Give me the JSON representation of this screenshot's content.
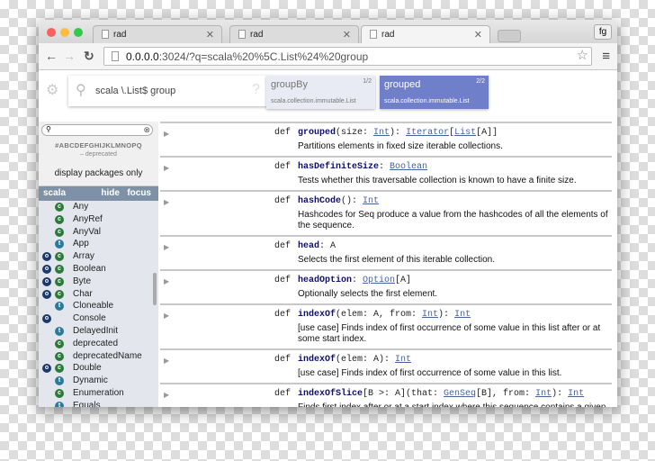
{
  "browser": {
    "tabs": [
      {
        "title": "rad"
      },
      {
        "title": "rad"
      },
      {
        "title": "rad"
      }
    ],
    "profile": "fg",
    "url_host": "0.0.0.0",
    "url_rest": ":3024/?q=scala%20%5C.List%24%20group"
  },
  "search": {
    "query": "scala \\.List$ group",
    "help": "?",
    "results": [
      {
        "name": "groupBy",
        "count": "1/2",
        "path": "scala.collection.immutable.List"
      },
      {
        "name": "grouped",
        "count": "2/2",
        "path": "scala.collection.immutable.List",
        "active": true
      }
    ]
  },
  "colors": {
    "active_result": "#6f7fc9",
    "inactive_result": "#e8eaf4",
    "package_header": "#7f91a6"
  },
  "sidebar": {
    "filter": "",
    "alphabet": "#ABCDEFGHIJKLMNOPQ",
    "deprecated": "– deprecated",
    "display_packages": "display packages only",
    "package": "scala",
    "hide": "hide",
    "focus": "focus",
    "items": [
      {
        "name": "Any",
        "o": false,
        "k": "c"
      },
      {
        "name": "AnyRef",
        "o": false,
        "k": "c"
      },
      {
        "name": "AnyVal",
        "o": false,
        "k": "c"
      },
      {
        "name": "App",
        "o": false,
        "k": "t"
      },
      {
        "name": "Array",
        "o": true,
        "k": "c"
      },
      {
        "name": "Boolean",
        "o": true,
        "k": "c"
      },
      {
        "name": "Byte",
        "o": true,
        "k": "c"
      },
      {
        "name": "Char",
        "o": true,
        "k": "c"
      },
      {
        "name": "Cloneable",
        "o": false,
        "k": "t"
      },
      {
        "name": "Console",
        "o": true,
        "k": ""
      },
      {
        "name": "DelayedInit",
        "o": false,
        "k": "t"
      },
      {
        "name": "deprecated",
        "o": false,
        "k": "c"
      },
      {
        "name": "deprecatedName",
        "o": false,
        "k": "c"
      },
      {
        "name": "Double",
        "o": true,
        "k": "c"
      },
      {
        "name": "Dynamic",
        "o": false,
        "k": "t"
      },
      {
        "name": "Enumeration",
        "o": false,
        "k": "c"
      },
      {
        "name": "Equals",
        "o": false,
        "k": "t"
      }
    ]
  },
  "members": [
    {
      "def": "def",
      "name": "grouped",
      "sig": [
        {
          "s": "(size: "
        },
        {
          "s": "Int",
          "l": 1
        },
        {
          "s": "): "
        },
        {
          "s": "Iterator",
          "l": 1
        },
        {
          "s": "["
        },
        {
          "s": "List",
          "l": 1
        },
        {
          "s": "[A]]"
        }
      ],
      "desc": "Partitions elements in fixed size iterable collections."
    },
    {
      "def": "def",
      "name": "hasDefiniteSize",
      "sig": [
        {
          "s": ": "
        },
        {
          "s": "Boolean",
          "l": 1
        }
      ],
      "desc": "Tests whether this traversable collection is known to have a finite size."
    },
    {
      "def": "def",
      "name": "hashCode",
      "sig": [
        {
          "s": "(): "
        },
        {
          "s": "Int",
          "l": 1
        }
      ],
      "desc": "Hashcodes for Seq produce a value from the hashcodes of all the elements of the sequence."
    },
    {
      "def": "def",
      "name": "head",
      "sig": [
        {
          "s": ": A"
        }
      ],
      "desc": "Selects the first element of this iterable collection."
    },
    {
      "def": "def",
      "name": "headOption",
      "sig": [
        {
          "s": ": "
        },
        {
          "s": "Option",
          "l": 1
        },
        {
          "s": "[A]"
        }
      ],
      "desc": "Optionally selects the first element."
    },
    {
      "def": "def",
      "name": "indexOf",
      "sig": [
        {
          "s": "(elem: A, from: "
        },
        {
          "s": "Int",
          "l": 1
        },
        {
          "s": "): "
        },
        {
          "s": "Int",
          "l": 1
        }
      ],
      "desc": "[use case] Finds index of first occurrence of some value in this list after or at some start index."
    },
    {
      "def": "def",
      "name": "indexOf",
      "sig": [
        {
          "s": "(elem: A): "
        },
        {
          "s": "Int",
          "l": 1
        }
      ],
      "desc": "[use case] Finds index of first occurrence of some value in this list."
    },
    {
      "def": "def",
      "name": "indexOfSlice",
      "sig": [
        {
          "s": "[B >: A](that: "
        },
        {
          "s": "GenSeq",
          "l": 1
        },
        {
          "s": "[B], from: "
        },
        {
          "s": "Int",
          "l": 1
        },
        {
          "s": "): "
        },
        {
          "s": "Int",
          "l": 1
        }
      ],
      "desc": "Finds first index after or at a start index where this sequence contains a given sequence as a slice."
    }
  ]
}
